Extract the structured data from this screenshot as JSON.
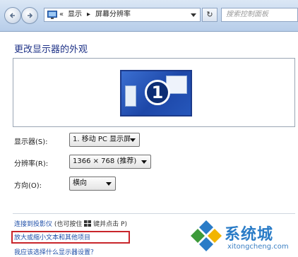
{
  "toolbar": {
    "breadcrumb_prefix": "«",
    "breadcrumb_1": "显示",
    "breadcrumb_sep": "▸",
    "breadcrumb_2": "屏幕分辨率",
    "refresh_symbol": "↻",
    "search_placeholder": "搜索控制面板"
  },
  "page": {
    "title": "更改显示器的外观",
    "monitor_number": "1"
  },
  "settings": {
    "display_label": "显示器(S):",
    "display_value": "1. 移动 PC 显示屏",
    "resolution_label": "分辨率(R):",
    "resolution_value": "1366 × 768 (推荐)",
    "orientation_label": "方向(O):",
    "orientation_value": "横向"
  },
  "links": {
    "projector_link": "连接到投影仪",
    "projector_hint_prefix": "(也可按住",
    "projector_hint_suffix": "键并点击 P)",
    "enlarge_text_link": "放大或缩小文本和其他项目",
    "which_settings_link": "我应该选择什么显示器设置？"
  },
  "watermark": {
    "title": "系统城",
    "url": "xitongcheng.com"
  },
  "colors": {
    "heading": "#1e3287",
    "link": "#1e4ea8",
    "highlight_box": "#c8252b",
    "watermark": "#2a7cc7"
  }
}
